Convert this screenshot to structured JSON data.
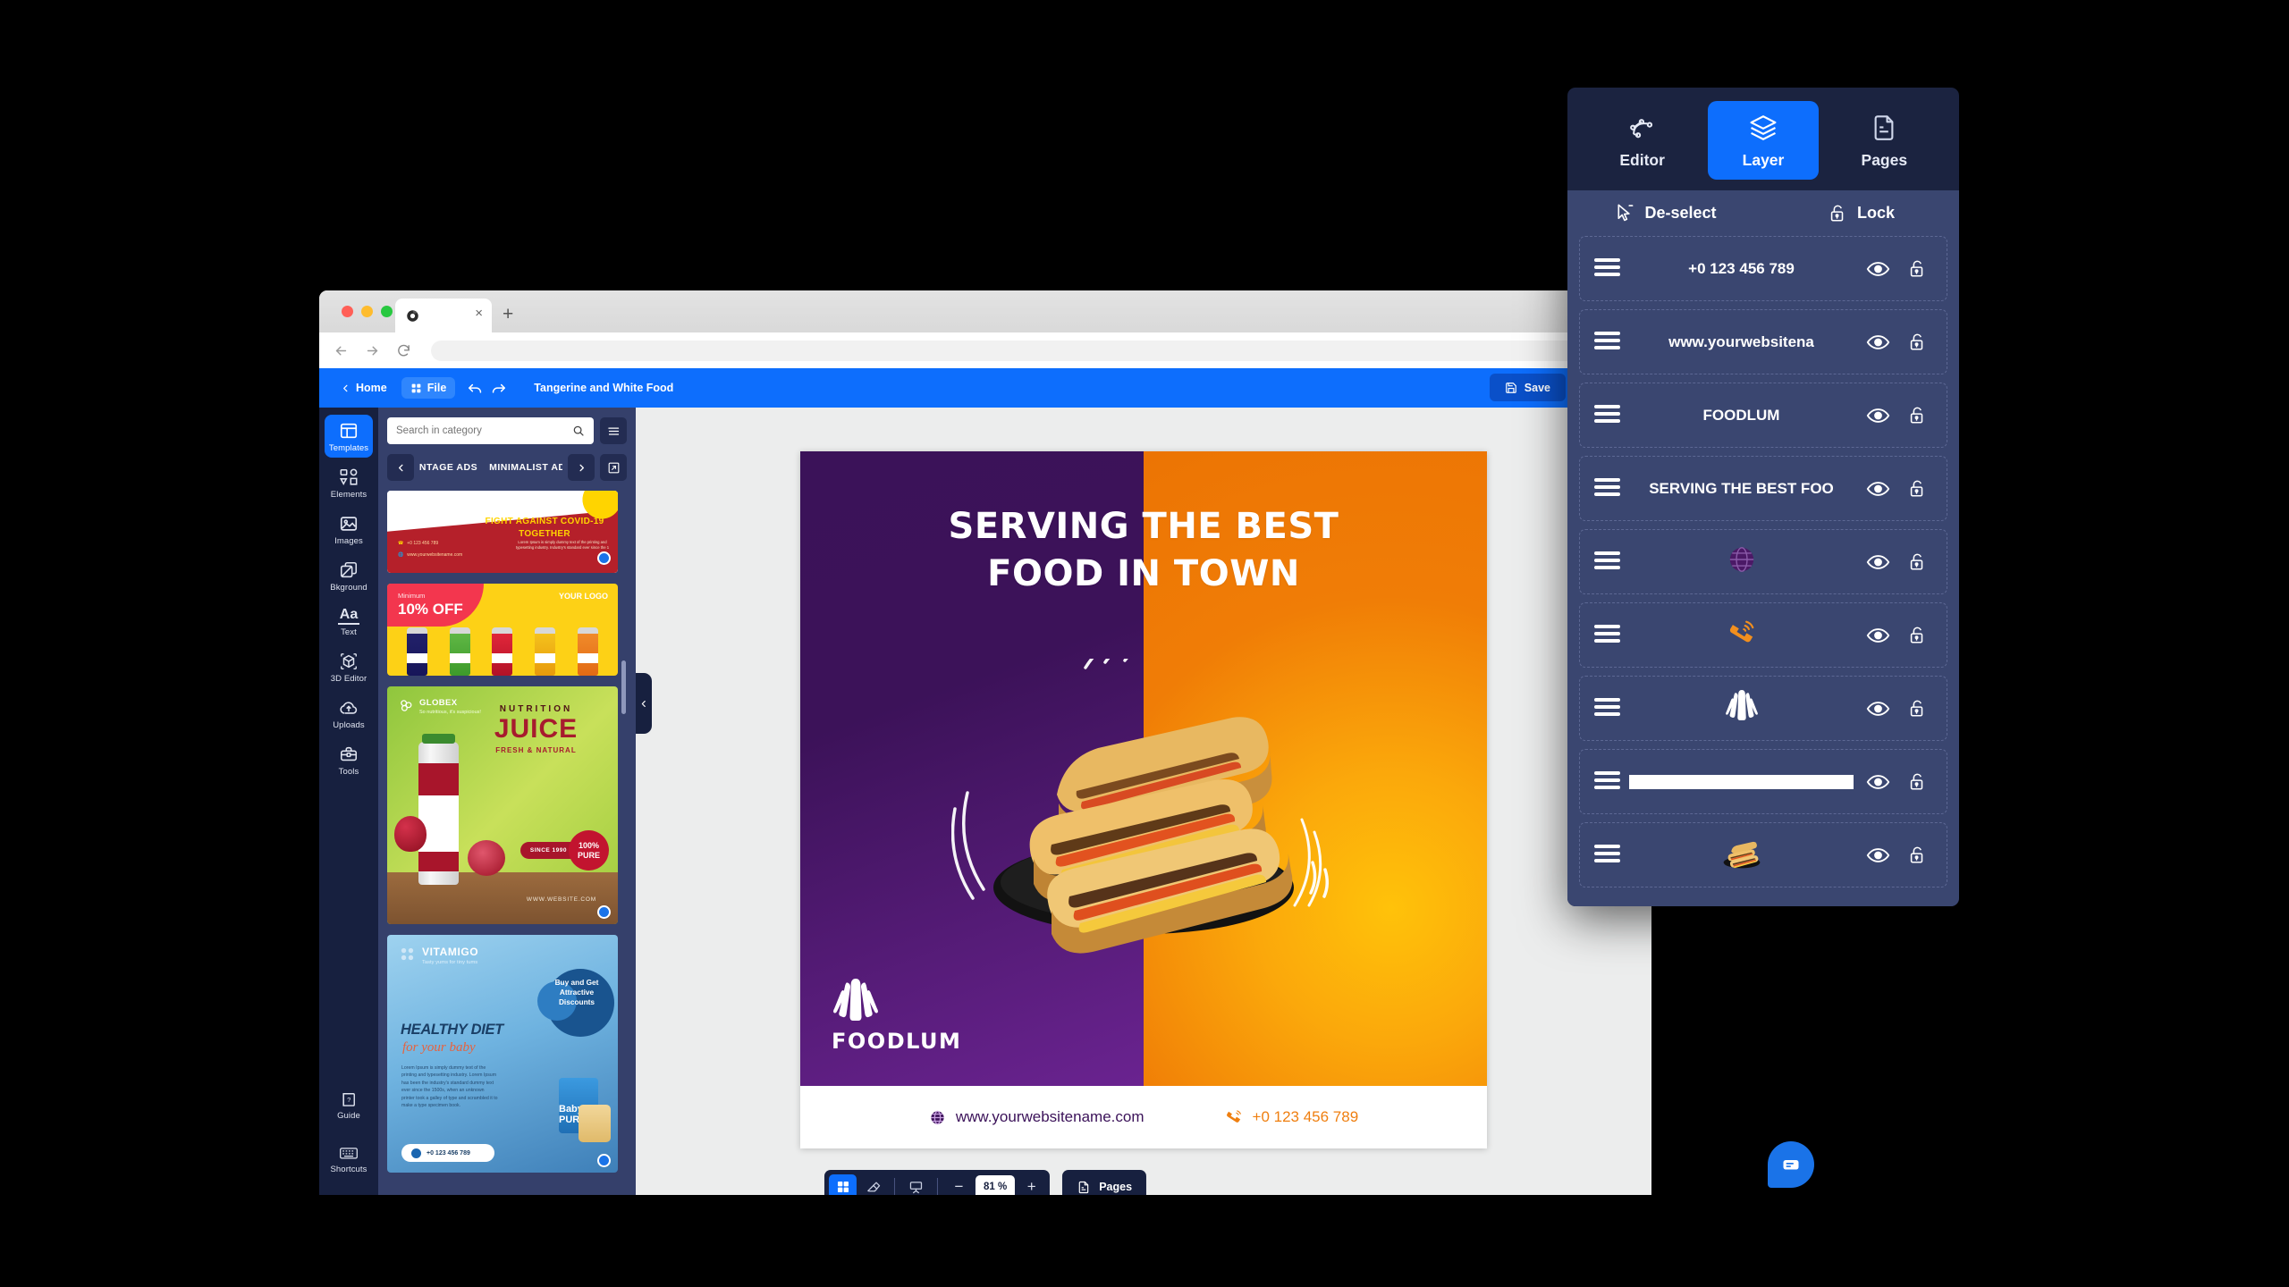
{
  "browser": {
    "tab_close": "×",
    "new_tab": "+",
    "back_icon": "back-arrow-icon",
    "forward_icon": "forward-arrow-icon",
    "reload_icon": "reload-icon",
    "url_value": ""
  },
  "appbar": {
    "home": "Home",
    "file": "File",
    "undo_icon": "undo-icon",
    "redo_icon": "redo-icon",
    "doc_title": "Tangerine and White Food",
    "save": "Save"
  },
  "rail": {
    "items": [
      {
        "label": "Templates",
        "icon": "templates-icon",
        "active": true
      },
      {
        "label": "Elements",
        "icon": "elements-icon",
        "active": false
      },
      {
        "label": "Images",
        "icon": "images-icon",
        "active": false
      },
      {
        "label": "Bkground",
        "icon": "background-icon",
        "active": false
      },
      {
        "label": "Text",
        "icon": "text-icon",
        "active": false
      },
      {
        "label": "3D Editor",
        "icon": "cube-icon",
        "active": false
      },
      {
        "label": "Uploads",
        "icon": "upload-cloud-icon",
        "active": false
      },
      {
        "label": "Tools",
        "icon": "toolbox-icon",
        "active": false
      }
    ],
    "bottom": [
      {
        "label": "Guide",
        "icon": "book-question-icon"
      },
      {
        "label": "Shortcuts",
        "icon": "keyboard-icon"
      }
    ]
  },
  "templates_panel": {
    "search_placeholder": "Search in category",
    "search_value": "",
    "search_icon": "search-icon",
    "list_icon": "list-view-icon",
    "prev_icon": "chevron-left-icon",
    "next_icon": "chevron-right-icon",
    "expand_icon": "expand-icon",
    "categories": [
      "VINTAGE ADS",
      "MINIMALIST ADS"
    ],
    "thumbs": [
      {
        "name": "covid-ad-thumb",
        "title": "FIGHT AGAINST COVID-19 TOGETHER",
        "phone": "+0 123 456 789",
        "web": "www.yourwebsitename.com",
        "body": "Lorem Ipsum is simply dummy text of the printing and typesetting industry. Industry's standard ever since the 1"
      },
      {
        "name": "juice-offer-thumb",
        "minimum": "Minimum",
        "discount": "10% OFF",
        "logo": "YOUR LOGO"
      },
      {
        "name": "nutrition-juice-thumb",
        "brand": "GLOBEX",
        "tagline": "So nutritious, it's suspicious!",
        "kicker": "NUTRITION",
        "title": "JUICE",
        "sub": "FRESH & NATURAL",
        "badge_since": "SINCE 1990",
        "badge_pure": "100% PURE",
        "web": "WWW.WEBSITE.COM"
      },
      {
        "name": "healthy-diet-thumb",
        "brand": "VITAMIGO",
        "tagline": "Tasty yums for tiny tums",
        "circle": "Buy and Get Attractive Discounts",
        "title": "HEALTHY DIET",
        "subtitle": "for your baby",
        "body": "Lorem Ipsum is simply dummy text of the printing and typesetting industry. Lorem Ipsum has been the industry's standard dummy text ever since the 1500s, when an unknown printer took a galley of type and scrambled it to make a type specimen book.",
        "phone": "+0 123 456 789",
        "product": "Baby PUREE"
      }
    ]
  },
  "canvas": {
    "collapse_icon": "chevron-left-icon",
    "poster": {
      "headline_line1": "SERVING THE BEST",
      "headline_line2": "FOOD IN TOWN",
      "logo_name": "FOODLUM",
      "logo_icon": "shell-icon",
      "website": "www.yourwebsitename.com",
      "website_icon": "globe-icon",
      "phone": "+0 123 456 789",
      "phone_icon": "ringing-phone-icon",
      "colors": {
        "left": "#3b1259",
        "right": "#f08006",
        "accent_orange": "#ef7f10",
        "purple": "#3b1259"
      }
    }
  },
  "bottombar": {
    "grid_icon": "grid-icon",
    "eraser_icon": "eraser-icon",
    "present_icon": "presentation-icon",
    "minus": "−",
    "zoom": "81 %",
    "plus": "+",
    "pages": "Pages",
    "pages_icon": "page-icon"
  },
  "layer_panel": {
    "tabs": [
      {
        "label": "Editor",
        "icon": "pen-path-icon",
        "active": false
      },
      {
        "label": "Layer",
        "icon": "layers-icon",
        "active": true
      },
      {
        "label": "Pages",
        "icon": "page-icon",
        "active": false
      }
    ],
    "actions": [
      {
        "label": "De-select",
        "icon": "cursor-deselect-icon"
      },
      {
        "label": "Lock",
        "icon": "unlock-icon"
      }
    ],
    "rows": [
      {
        "name": "layer-row-phone",
        "label": "+0 123 456 789",
        "kind": "text"
      },
      {
        "name": "layer-row-website",
        "label": "www.yourwebsitena",
        "kind": "text"
      },
      {
        "name": "layer-row-foodlum",
        "label": "FOODLUM",
        "kind": "text"
      },
      {
        "name": "layer-row-headline",
        "label": "SERVING THE BEST FOO",
        "kind": "text"
      },
      {
        "name": "layer-row-globe",
        "label": "",
        "kind": "globe-icon"
      },
      {
        "name": "layer-row-phone-icon",
        "label": "",
        "kind": "ringing-phone-icon"
      },
      {
        "name": "layer-row-shell",
        "label": "",
        "kind": "shell-icon"
      },
      {
        "name": "layer-row-whitebar",
        "label": "",
        "kind": "white-bar"
      },
      {
        "name": "layer-row-sandwich",
        "label": "",
        "kind": "sandwich-image"
      }
    ],
    "eye_icon": "eye-icon",
    "lock_icon": "unlock-icon",
    "grip_icon": "drag-handle-icon"
  },
  "chat": {
    "icon": "chat-bubble-icon"
  }
}
